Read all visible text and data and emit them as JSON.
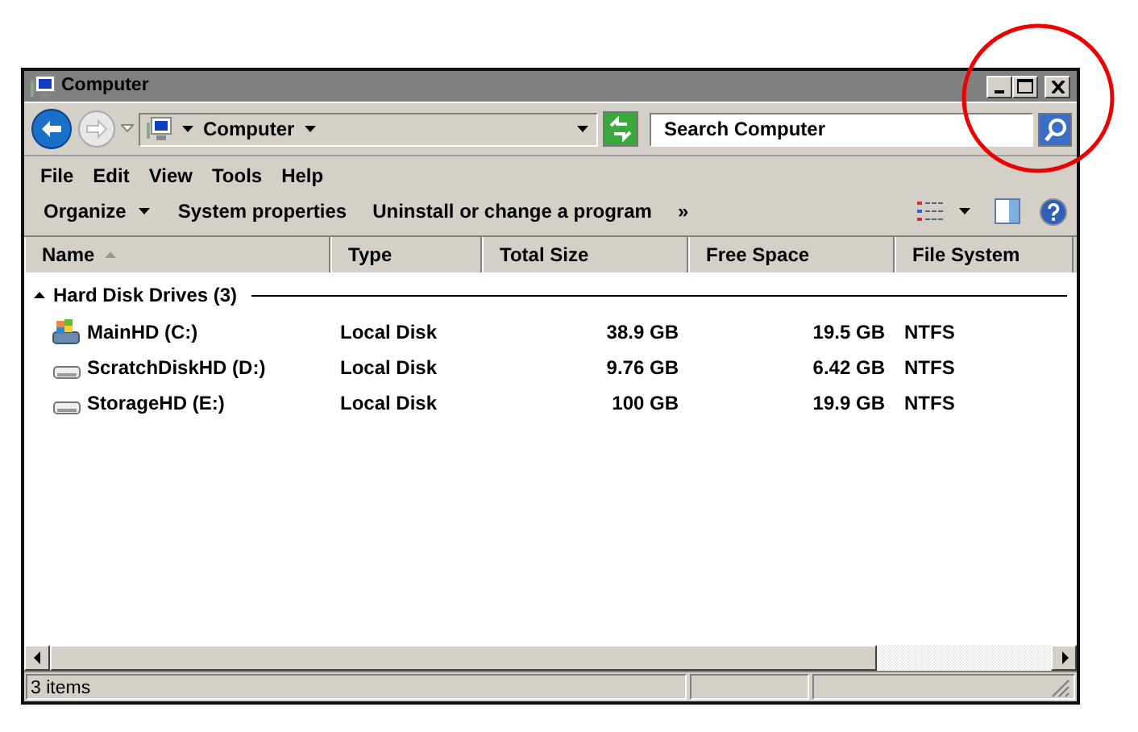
{
  "window": {
    "title": "Computer"
  },
  "address_bar": {
    "location": "Computer"
  },
  "search": {
    "placeholder": "Search Computer"
  },
  "menu": [
    "File",
    "Edit",
    "View",
    "Tools",
    "Help"
  ],
  "toolbar": [
    {
      "label": "Organize",
      "kind": "dropdown"
    },
    {
      "label": "System properties",
      "kind": "button"
    },
    {
      "label": "Uninstall or change a program",
      "kind": "button"
    },
    {
      "label": "»",
      "kind": "overflow"
    }
  ],
  "columns": [
    {
      "label": "Name",
      "sorted": true
    },
    {
      "label": "Type",
      "sorted": false
    },
    {
      "label": "Total Size",
      "sorted": false
    },
    {
      "label": "Free Space",
      "sorted": false
    },
    {
      "label": "File System",
      "sorted": false
    }
  ],
  "groups": [
    {
      "label": "Hard Disk Drives (3)",
      "expanded": true,
      "items": [
        {
          "name": "MainHD (C:)",
          "kind": "system",
          "type": "Local Disk",
          "total_size": "38.9 GB",
          "free_space": "19.5 GB",
          "file_system": "NTFS"
        },
        {
          "name": "ScratchDiskHD (D:)",
          "kind": "disk",
          "type": "Local Disk",
          "total_size": "9.76 GB",
          "free_space": "6.42 GB",
          "file_system": "NTFS"
        },
        {
          "name": "StorageHD (E:)",
          "kind": "disk",
          "type": "Local Disk",
          "total_size": "100 GB",
          "free_space": "19.9 GB",
          "file_system": "NTFS"
        }
      ]
    }
  ],
  "status_bar": {
    "text": "3 items"
  }
}
